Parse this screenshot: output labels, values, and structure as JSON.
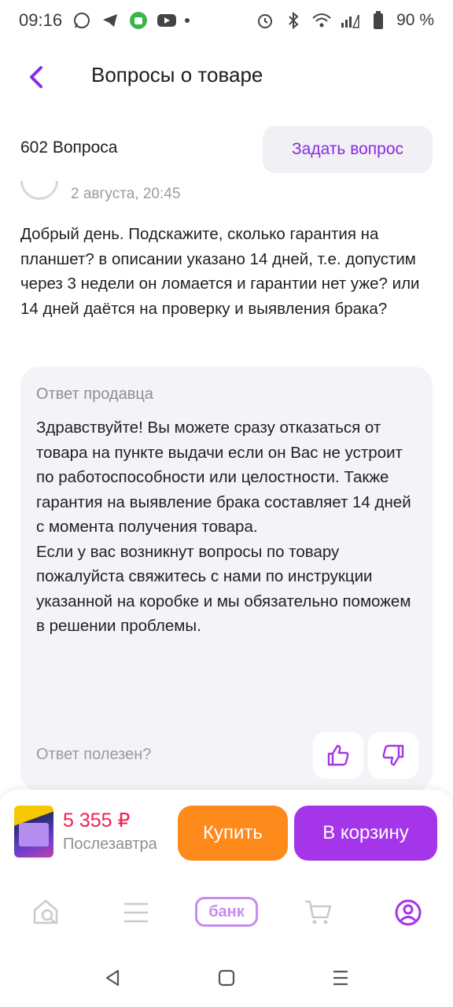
{
  "status_bar": {
    "time": "09:16",
    "battery": "90 %"
  },
  "header": {
    "title": "Вопросы о товаре"
  },
  "questions": {
    "count_label": "602 Вопроса",
    "ask_button": "Задать вопрос"
  },
  "question": {
    "date": "2 августа, 20:45",
    "text": "Добрый день. Подскажите, сколько гарантия на планшет? в описании указано 14 дней, т.е. допустим через 3 недели он ломается и гарантии нет уже? или 14 дней даётся на проверку и выявления брака?"
  },
  "answer": {
    "title": "Ответ продавца",
    "text": "Здравствуйте! Вы можете сразу отказаться от товара на пункте выдачи если он Вас не устроит по работоспособности или целостности. Также гарантия на выявление брака составляет 14 дней с момента получения товара.\nЕсли у вас возникнут вопросы по товару пожалуйста свяжитесь с нами по инструкции указанной на коробке и мы обязательно поможем в решении проблемы.",
    "helpful_label": "Ответ полезен?"
  },
  "buy_bar": {
    "price": "5 355 ₽",
    "delivery": "Послезавтра",
    "buy_label": "Купить",
    "cart_label": "В корзину"
  },
  "tab_bar": {
    "bank_label": "банк"
  },
  "colors": {
    "accent": "#8a2be2",
    "price": "#f0224f",
    "buy": "#ff8a1c",
    "cart": "#a535e8"
  }
}
